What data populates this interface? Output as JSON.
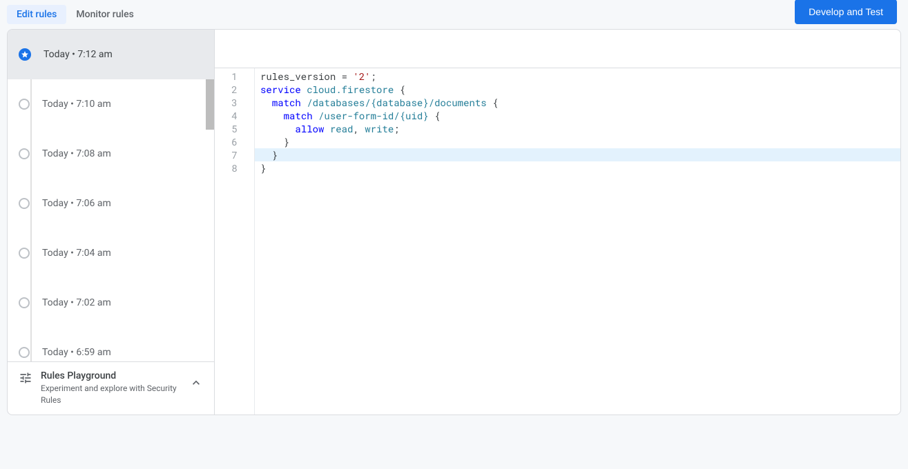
{
  "tabs": {
    "edit": "Edit rules",
    "monitor": "Monitor rules"
  },
  "primary_button": "Develop and Test",
  "history": [
    {
      "label": "Today • 7:12 am",
      "starred": true,
      "selected": true
    },
    {
      "label": "Today • 7:10 am",
      "starred": false,
      "selected": false
    },
    {
      "label": "Today • 7:08 am",
      "starred": false,
      "selected": false
    },
    {
      "label": "Today • 7:06 am",
      "starred": false,
      "selected": false
    },
    {
      "label": "Today • 7:04 am",
      "starred": false,
      "selected": false
    },
    {
      "label": "Today • 7:02 am",
      "starred": false,
      "selected": false
    },
    {
      "label": "Today • 6:59 am",
      "starred": false,
      "selected": false
    }
  ],
  "playground": {
    "title": "Rules Playground",
    "subtitle": "Experiment and explore with Security Rules"
  },
  "editor": {
    "line_count": 8,
    "highlighted_line": 7,
    "lines": [
      [
        {
          "t": "rules_version ",
          "c": "plain"
        },
        {
          "t": "= ",
          "c": "plain"
        },
        {
          "t": "'2'",
          "c": "str"
        },
        {
          "t": ";",
          "c": "plain"
        }
      ],
      [
        {
          "t": "service ",
          "c": "kw"
        },
        {
          "t": "cloud.firestore ",
          "c": "path"
        },
        {
          "t": "{",
          "c": "plain"
        }
      ],
      [
        {
          "t": "  ",
          "c": "plain"
        },
        {
          "t": "match ",
          "c": "kw"
        },
        {
          "t": "/databases/{database}/documents ",
          "c": "path"
        },
        {
          "t": "{",
          "c": "plain"
        }
      ],
      [
        {
          "t": "    ",
          "c": "plain"
        },
        {
          "t": "match ",
          "c": "kw"
        },
        {
          "t": "/user-form-id/{uid} ",
          "c": "path"
        },
        {
          "t": "{",
          "c": "plain"
        }
      ],
      [
        {
          "t": "      ",
          "c": "plain"
        },
        {
          "t": "allow ",
          "c": "kw"
        },
        {
          "t": "read",
          "c": "path"
        },
        {
          "t": ", ",
          "c": "plain"
        },
        {
          "t": "write",
          "c": "path"
        },
        {
          "t": ";",
          "c": "plain"
        }
      ],
      [
        {
          "t": "    }",
          "c": "plain"
        }
      ],
      [
        {
          "t": "  }",
          "c": "plain"
        }
      ],
      [
        {
          "t": "}",
          "c": "plain"
        }
      ]
    ]
  }
}
